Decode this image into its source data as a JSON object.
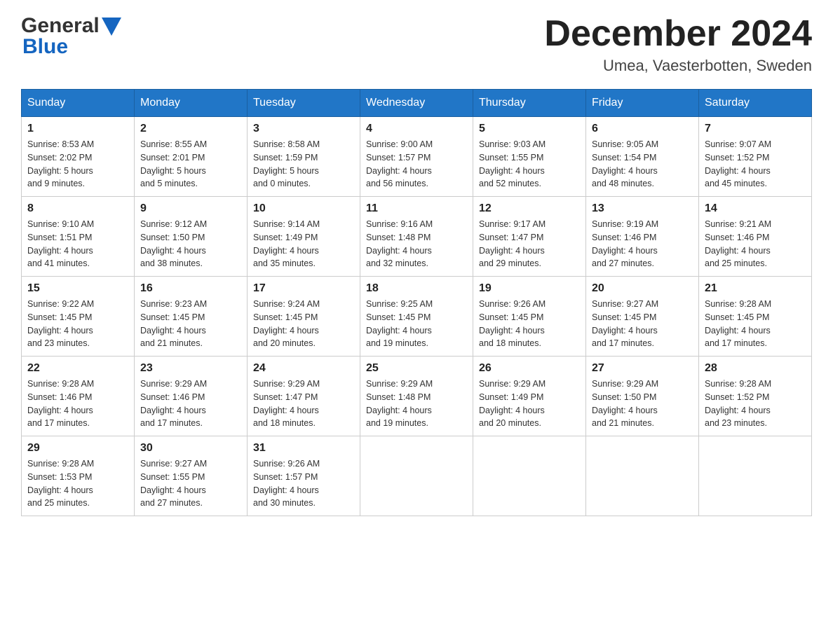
{
  "header": {
    "logo": {
      "text_general": "General",
      "text_blue": "Blue",
      "alt": "GeneralBlue logo"
    },
    "title": "December 2024",
    "location": "Umea, Vaesterbotten, Sweden"
  },
  "calendar": {
    "weekdays": [
      "Sunday",
      "Monday",
      "Tuesday",
      "Wednesday",
      "Thursday",
      "Friday",
      "Saturday"
    ],
    "weeks": [
      [
        {
          "day": "1",
          "sunrise": "8:53 AM",
          "sunset": "2:02 PM",
          "daylight": "5 hours and 9 minutes."
        },
        {
          "day": "2",
          "sunrise": "8:55 AM",
          "sunset": "2:01 PM",
          "daylight": "5 hours and 5 minutes."
        },
        {
          "day": "3",
          "sunrise": "8:58 AM",
          "sunset": "1:59 PM",
          "daylight": "5 hours and 0 minutes."
        },
        {
          "day": "4",
          "sunrise": "9:00 AM",
          "sunset": "1:57 PM",
          "daylight": "4 hours and 56 minutes."
        },
        {
          "day": "5",
          "sunrise": "9:03 AM",
          "sunset": "1:55 PM",
          "daylight": "4 hours and 52 minutes."
        },
        {
          "day": "6",
          "sunrise": "9:05 AM",
          "sunset": "1:54 PM",
          "daylight": "4 hours and 48 minutes."
        },
        {
          "day": "7",
          "sunrise": "9:07 AM",
          "sunset": "1:52 PM",
          "daylight": "4 hours and 45 minutes."
        }
      ],
      [
        {
          "day": "8",
          "sunrise": "9:10 AM",
          "sunset": "1:51 PM",
          "daylight": "4 hours and 41 minutes."
        },
        {
          "day": "9",
          "sunrise": "9:12 AM",
          "sunset": "1:50 PM",
          "daylight": "4 hours and 38 minutes."
        },
        {
          "day": "10",
          "sunrise": "9:14 AM",
          "sunset": "1:49 PM",
          "daylight": "4 hours and 35 minutes."
        },
        {
          "day": "11",
          "sunrise": "9:16 AM",
          "sunset": "1:48 PM",
          "daylight": "4 hours and 32 minutes."
        },
        {
          "day": "12",
          "sunrise": "9:17 AM",
          "sunset": "1:47 PM",
          "daylight": "4 hours and 29 minutes."
        },
        {
          "day": "13",
          "sunrise": "9:19 AM",
          "sunset": "1:46 PM",
          "daylight": "4 hours and 27 minutes."
        },
        {
          "day": "14",
          "sunrise": "9:21 AM",
          "sunset": "1:46 PM",
          "daylight": "4 hours and 25 minutes."
        }
      ],
      [
        {
          "day": "15",
          "sunrise": "9:22 AM",
          "sunset": "1:45 PM",
          "daylight": "4 hours and 23 minutes."
        },
        {
          "day": "16",
          "sunrise": "9:23 AM",
          "sunset": "1:45 PM",
          "daylight": "4 hours and 21 minutes."
        },
        {
          "day": "17",
          "sunrise": "9:24 AM",
          "sunset": "1:45 PM",
          "daylight": "4 hours and 20 minutes."
        },
        {
          "day": "18",
          "sunrise": "9:25 AM",
          "sunset": "1:45 PM",
          "daylight": "4 hours and 19 minutes."
        },
        {
          "day": "19",
          "sunrise": "9:26 AM",
          "sunset": "1:45 PM",
          "daylight": "4 hours and 18 minutes."
        },
        {
          "day": "20",
          "sunrise": "9:27 AM",
          "sunset": "1:45 PM",
          "daylight": "4 hours and 17 minutes."
        },
        {
          "day": "21",
          "sunrise": "9:28 AM",
          "sunset": "1:45 PM",
          "daylight": "4 hours and 17 minutes."
        }
      ],
      [
        {
          "day": "22",
          "sunrise": "9:28 AM",
          "sunset": "1:46 PM",
          "daylight": "4 hours and 17 minutes."
        },
        {
          "day": "23",
          "sunrise": "9:29 AM",
          "sunset": "1:46 PM",
          "daylight": "4 hours and 17 minutes."
        },
        {
          "day": "24",
          "sunrise": "9:29 AM",
          "sunset": "1:47 PM",
          "daylight": "4 hours and 18 minutes."
        },
        {
          "day": "25",
          "sunrise": "9:29 AM",
          "sunset": "1:48 PM",
          "daylight": "4 hours and 19 minutes."
        },
        {
          "day": "26",
          "sunrise": "9:29 AM",
          "sunset": "1:49 PM",
          "daylight": "4 hours and 20 minutes."
        },
        {
          "day": "27",
          "sunrise": "9:29 AM",
          "sunset": "1:50 PM",
          "daylight": "4 hours and 21 minutes."
        },
        {
          "day": "28",
          "sunrise": "9:28 AM",
          "sunset": "1:52 PM",
          "daylight": "4 hours and 23 minutes."
        }
      ],
      [
        {
          "day": "29",
          "sunrise": "9:28 AM",
          "sunset": "1:53 PM",
          "daylight": "4 hours and 25 minutes."
        },
        {
          "day": "30",
          "sunrise": "9:27 AM",
          "sunset": "1:55 PM",
          "daylight": "4 hours and 27 minutes."
        },
        {
          "day": "31",
          "sunrise": "9:26 AM",
          "sunset": "1:57 PM",
          "daylight": "4 hours and 30 minutes."
        },
        null,
        null,
        null,
        null
      ]
    ]
  }
}
